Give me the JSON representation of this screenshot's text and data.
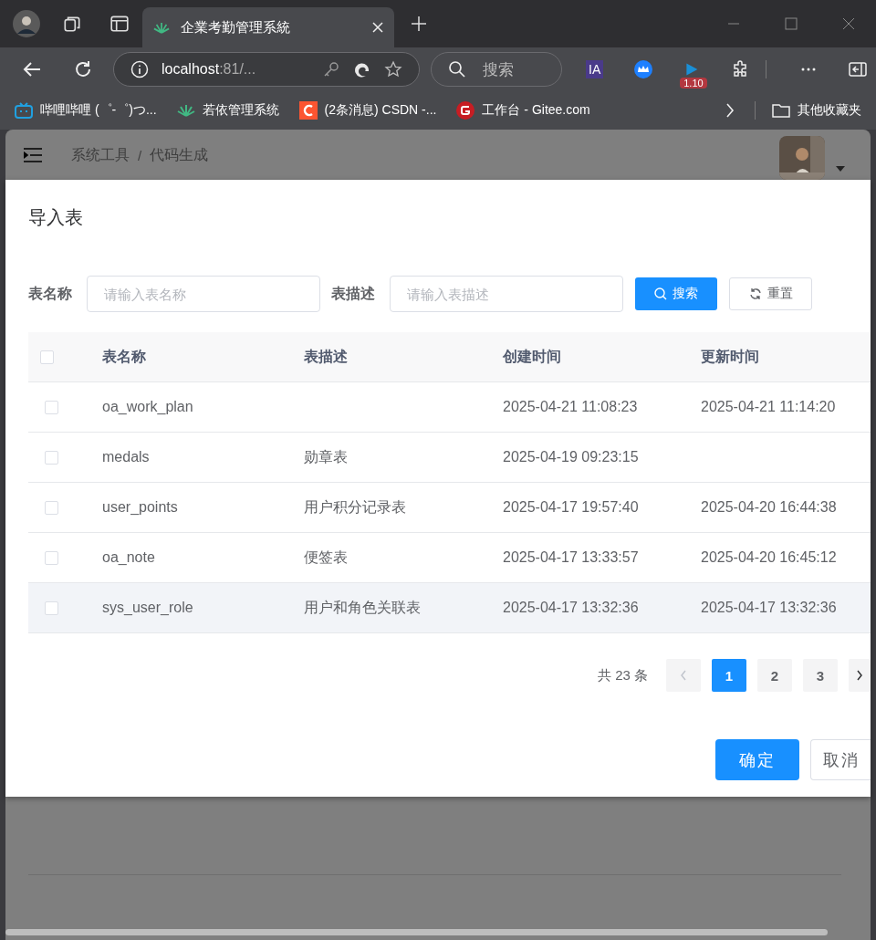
{
  "browser": {
    "tabs": [
      {
        "title": "企業考勤管理系統",
        "selected": true
      }
    ],
    "address": {
      "host": "localhost",
      "rest": ":81/..."
    },
    "search": {
      "placeholder": "搜索"
    },
    "extensions": {
      "label": "IA",
      "badge": "1.10"
    },
    "bookmarks": [
      {
        "label": "哔哩哔哩 (゜-゜)つ...",
        "kind": "tv"
      },
      {
        "label": "若依管理系统",
        "kind": "leaf"
      },
      {
        "label": "(2条消息) CSDN -...",
        "kind": "csdn"
      },
      {
        "label": "工作台 - Gitee.com",
        "kind": "gitee"
      }
    ],
    "other_bookmarks": "其他收藏夹"
  },
  "page": {
    "breadcrumb": [
      "系统工具",
      "代码生成"
    ],
    "separator": "/"
  },
  "dialog": {
    "title": "导入表",
    "filters": [
      {
        "label": "表名称",
        "placeholder": "请输入表名称"
      },
      {
        "label": "表描述",
        "placeholder": "请输入表描述"
      }
    ],
    "actions": [
      {
        "label": "搜索",
        "kind": "primary"
      },
      {
        "label": "重置",
        "kind": "reset"
      }
    ],
    "table": {
      "all_checked": false,
      "columns": [
        "表名称",
        "表描述",
        "创建时间",
        "更新时间"
      ],
      "rows": [
        {
          "checked": false,
          "highlighted": false,
          "cells": [
            "oa_work_plan",
            "",
            "2025-04-21 11:08:23",
            "2025-04-21 11:14:20"
          ]
        },
        {
          "checked": false,
          "highlighted": false,
          "cells": [
            "medals",
            "勋章表",
            "2025-04-19 09:23:15",
            ""
          ]
        },
        {
          "checked": false,
          "highlighted": false,
          "cells": [
            "user_points",
            "用户积分记录表",
            "2025-04-17 19:57:40",
            "2025-04-20 16:44:38"
          ]
        },
        {
          "checked": false,
          "highlighted": false,
          "cells": [
            "oa_note",
            "便签表",
            "2025-04-17 13:33:57",
            "2025-04-20 16:45:12"
          ]
        },
        {
          "checked": false,
          "highlighted": true,
          "cells": [
            "sys_user_role",
            "用户和角色关联表",
            "2025-04-17 13:32:36",
            "2025-04-17 13:32:36"
          ]
        }
      ]
    },
    "pagination": {
      "total": "共 23 条",
      "prev_disabled": true,
      "pages": [
        {
          "label": "1",
          "selected": true
        },
        {
          "label": "2",
          "selected": false
        },
        {
          "label": "3",
          "selected": false
        }
      ]
    },
    "footer": [
      {
        "label": "确定",
        "kind": "primary"
      },
      {
        "label": "取消",
        "kind": "default"
      }
    ]
  }
}
